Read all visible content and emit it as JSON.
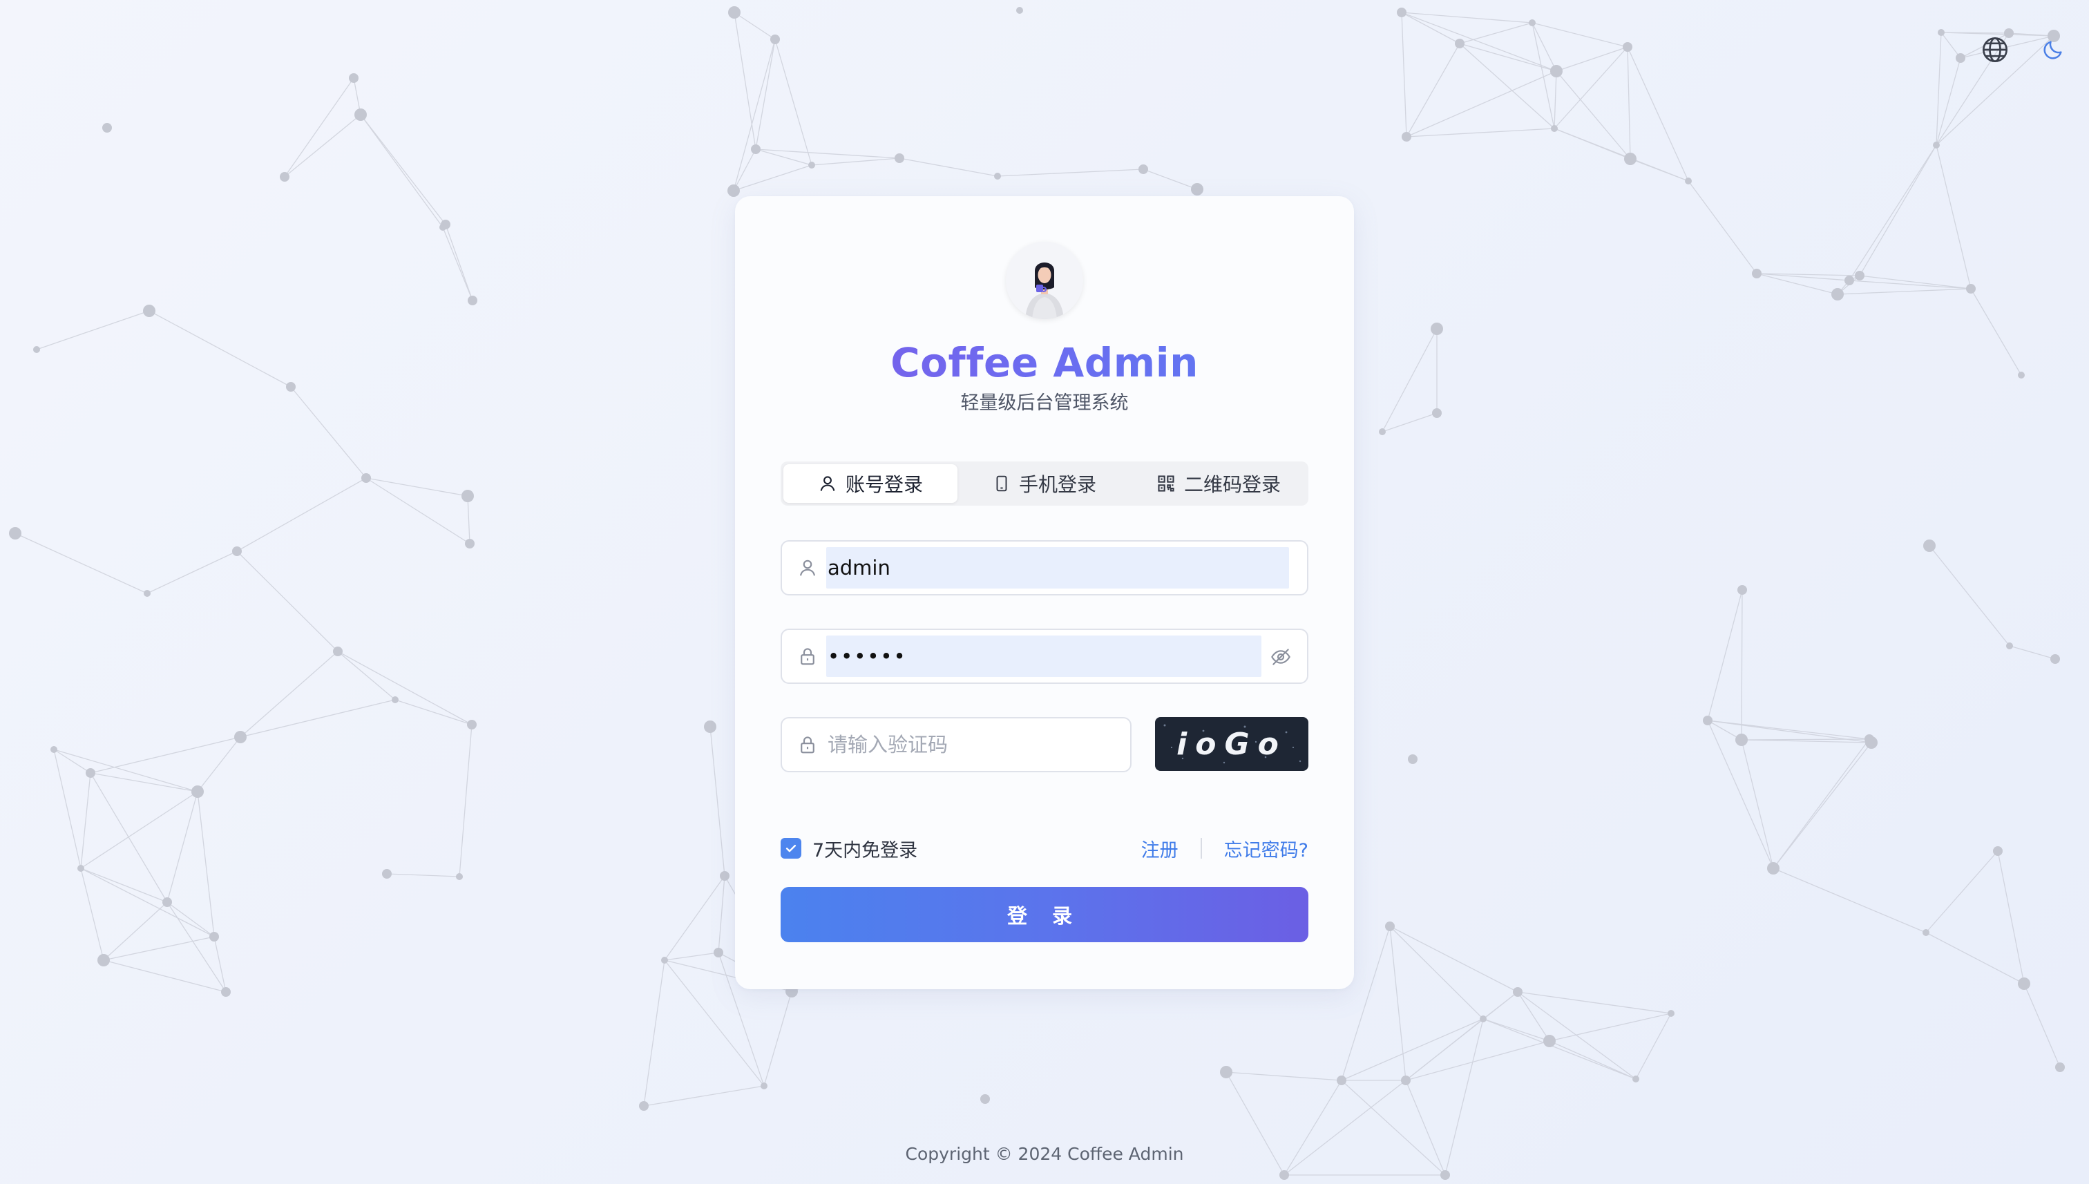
{
  "header": {
    "language_icon": "globe-icon",
    "theme_icon": "moon-icon"
  },
  "login": {
    "title": "Coffee Admin",
    "subtitle": "轻量级后台管理系统",
    "tabs": [
      {
        "label": "账号登录",
        "icon": "user-icon",
        "active": true
      },
      {
        "label": "手机登录",
        "icon": "phone-icon",
        "active": false
      },
      {
        "label": "二维码登录",
        "icon": "qrcode-icon",
        "active": false
      }
    ],
    "username": {
      "value": "admin",
      "icon": "user-icon"
    },
    "password": {
      "value": "••••••",
      "icon": "lock-icon",
      "toggle_icon": "eye-off-icon"
    },
    "captcha": {
      "placeholder": "请输入验证码",
      "icon": "lock-icon",
      "image_text": "ioGo"
    },
    "remember_label": "7天内免登录",
    "remember_checked": true,
    "register_link": "注册",
    "forgot_link": "忘记密码?",
    "submit_label": "登 录"
  },
  "footer": {
    "copyright": "Copyright © 2024 Coffee Admin"
  },
  "colors": {
    "accent": "#4d85ee",
    "title_gradient_start": "#7d5ce8",
    "title_gradient_end": "#5a7df2",
    "button_gradient_start": "#4b82ee",
    "button_gradient_end": "#6b5fe4"
  }
}
